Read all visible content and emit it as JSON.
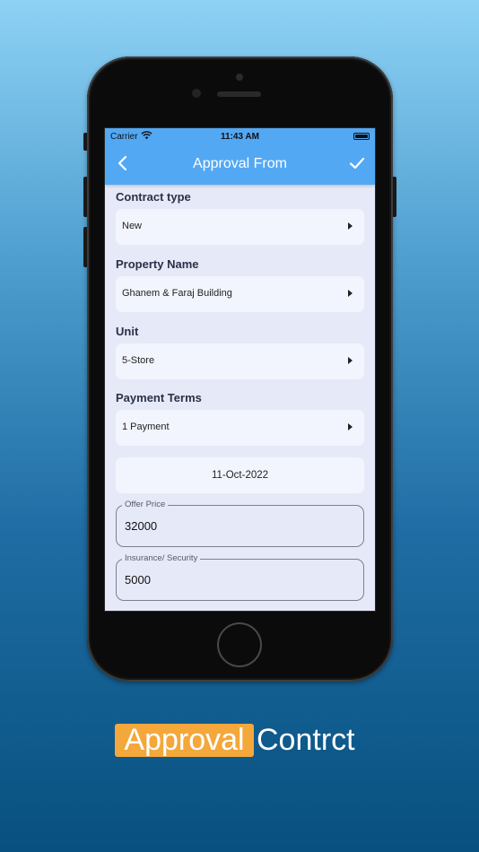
{
  "status_bar": {
    "carrier": "Carrier",
    "time": "11:43 AM"
  },
  "navbar": {
    "title": "Approval From",
    "back_icon": "chevron-left-icon",
    "confirm_icon": "checkmark-icon"
  },
  "form": {
    "contract_type": {
      "label": "Contract type",
      "value": "New"
    },
    "property_name": {
      "label": "Property Name",
      "value": "Ghanem & Faraj Building"
    },
    "unit": {
      "label": "Unit",
      "value": "5-Store"
    },
    "payment_terms": {
      "label": "Payment Terms",
      "value": "1 Payment"
    },
    "date": {
      "value": "11-Oct-2022"
    },
    "offer_price": {
      "label": "Offer Price",
      "value": "32000"
    },
    "insurance": {
      "label": "Insurance/ Security",
      "value": "5000"
    }
  },
  "caption": {
    "highlight": "Approval",
    "rest": "Contrct"
  },
  "colors": {
    "navbar": "#53a8f4",
    "screen_bg": "#e6e9f8",
    "field_bg": "#f3f5fe",
    "caption_highlight": "#f4a73a"
  }
}
